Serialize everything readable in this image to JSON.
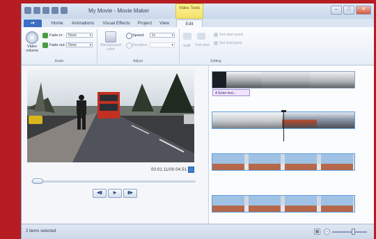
{
  "window": {
    "title": "My Movie - Movie Maker",
    "context_tab_group": "Video Tools"
  },
  "tabs": [
    {
      "label": ""
    },
    {
      "label": "Home"
    },
    {
      "label": "Animations"
    },
    {
      "label": "Visual Effects"
    },
    {
      "label": "Project"
    },
    {
      "label": "View"
    },
    {
      "label": "Edit",
      "active": true
    }
  ],
  "ribbon": {
    "audio": {
      "video_volume": "Video volume",
      "fade_in_label": "Fade in:",
      "fade_in_value": "None",
      "fade_out_label": "Fade out:",
      "fade_out_value": "None",
      "group": "Audio"
    },
    "adjust": {
      "background_color": "Background color",
      "speed_label": "Speed:",
      "speed_value": "1x",
      "duration_label": "Duration:",
      "group": "Adjust"
    },
    "editing": {
      "split": "Split",
      "trim_tool": "Trim tool",
      "set_start_point": "Set start point",
      "set_end_point": "Set end point",
      "group": "Editing"
    }
  },
  "preview": {
    "timecode": "00:01.11/00:04.51",
    "controls": [
      "◀▮",
      "▶",
      "▮▶"
    ]
  },
  "storyboard": {
    "caption": "A Enter text..."
  },
  "status": {
    "text": "2 items selected"
  },
  "colors": {
    "accent": "#3d7fd3",
    "clip_border": "#5b9ce0",
    "caption_border": "#a58ad7",
    "context_tab": "#f1e16a"
  }
}
